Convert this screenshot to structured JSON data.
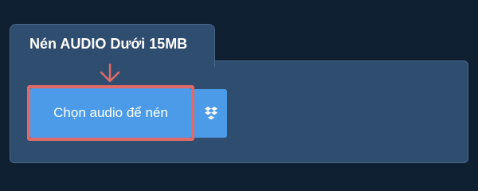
{
  "widget": {
    "tab_title": "Nén AUDIO Dưới 15MB",
    "choose_button_label": "Chọn audio để nén",
    "dropbox_icon": "dropbox-icon",
    "annotation_arrow_icon": "arrow-down-icon"
  },
  "colors": {
    "background": "#0f2033",
    "panel": "#2f4d6f",
    "panel_border": "#4b6788",
    "button": "#4c9be8",
    "highlight": "#e06a67",
    "text": "#ffffff"
  }
}
